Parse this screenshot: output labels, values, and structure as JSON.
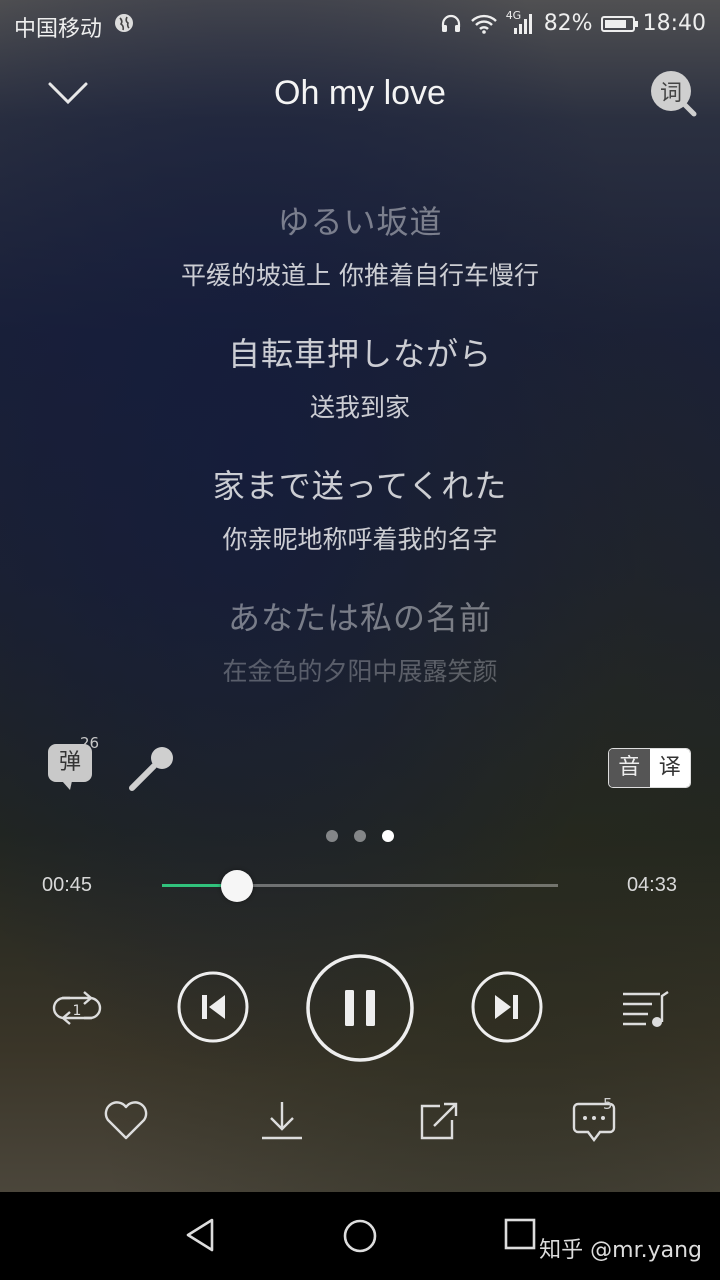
{
  "status": {
    "carrier": "中国移动",
    "network": "4G",
    "battery": "82%",
    "time": "18:40",
    "battery_level": 0.82
  },
  "header": {
    "title": "Oh my love",
    "lyric_search_icon": "词"
  },
  "lyrics": [
    {
      "jp": "ゆるい坂道",
      "cn": "平缓的坡道上 你推着自行车慢行"
    },
    {
      "jp": "自転車押しながら",
      "cn": "送我到家"
    },
    {
      "jp": "家まで送ってくれた",
      "cn": "你亲昵地称呼着我的名字"
    },
    {
      "jp": "あなたは私の名前",
      "cn": "在金色的夕阳中展露笑颜"
    }
  ],
  "tools": {
    "danmu_label": "弹",
    "danmu_count": "26",
    "toggle_left": "音",
    "toggle_right": "译"
  },
  "progress": {
    "current": "00:45",
    "total": "04:33",
    "fraction": 0.19
  },
  "controls": {
    "repeat_badge": "1"
  },
  "actions": {
    "comment_count": "5"
  },
  "nav": {
    "watermark": "知乎 @mr.yang"
  },
  "colors": {
    "accent": "#31c27c"
  }
}
